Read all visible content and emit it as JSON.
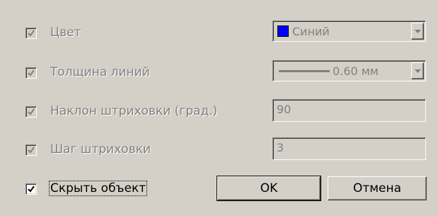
{
  "rows": {
    "color": {
      "label": "Цвет",
      "checked": true,
      "enabled": false,
      "value": "Синий",
      "swatch_color": "#0000ff"
    },
    "line_width": {
      "label": "Толщина линий",
      "checked": true,
      "enabled": false,
      "value": "0.60 мм"
    },
    "hatch_angle": {
      "label": "Наклон штриховки (град.)",
      "checked": true,
      "enabled": false,
      "value": "90"
    },
    "hatch_step": {
      "label": "Шаг штриховки",
      "checked": true,
      "enabled": false,
      "value": "3"
    },
    "hide_object": {
      "label": "Скрыть объект",
      "checked": true,
      "enabled": true
    }
  },
  "buttons": {
    "ok_label": "OK",
    "cancel_label": "Отмена"
  },
  "icons": {
    "combo_arrow": "chevron-down-icon",
    "check": "checkmark-icon"
  }
}
